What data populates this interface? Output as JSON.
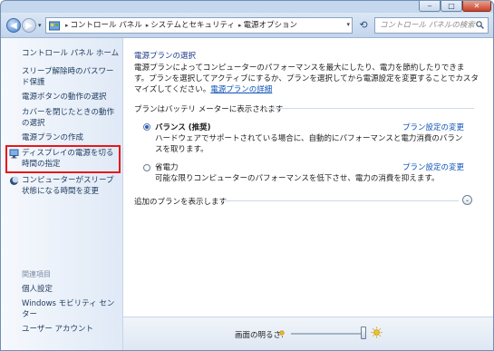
{
  "window": {
    "min": "‒",
    "max": "□",
    "close": "✕"
  },
  "nav": {
    "back": "◀",
    "forward": "▶",
    "dropdown": "▾",
    "breadcrumbs": [
      "コントロール パネル",
      "システムとセキュリティ",
      "電源オプション"
    ],
    "breadcrumb_separator": "▸",
    "address_dropdown": "▾",
    "refresh": "⟲",
    "search_placeholder": "コントロール パネルの検索"
  },
  "help": "?",
  "sidebar": {
    "title": "コントロール パネル ホーム",
    "links": [
      "スリープ解除時のパスワード保護",
      "電源ボタンの動作の選択",
      "カバーを閉じたときの動作の選択",
      "電源プランの作成",
      "ディスプレイの電源を切る時間の指定",
      "コンピューターがスリープ状態になる時間を変更"
    ],
    "related_heading": "関連項目",
    "related_links": [
      "個人設定",
      "Windows モビリティ センター",
      "ユーザー アカウント"
    ]
  },
  "main": {
    "title": "電源プランの選択",
    "description": "電源プランによってコンピューターのパフォーマンスを最大にしたり、電力を節約したりできます。プランを選択してアクティブにするか、プランを選択してから電源設定を変更することでカスタマイズしてください。",
    "description_link": "電源プランの詳細",
    "group_title": "プランはバッテリ メーターに表示されます",
    "plans": [
      {
        "name": "バランス (推奨)",
        "desc": "ハードウェアでサポートされている場合に、自動的にパフォーマンスと電力消費のバランスを取ります。",
        "link": "プラン設定の変更",
        "selected": true
      },
      {
        "name": "省電力",
        "desc": "可能な限りコンピューターのパフォーマンスを低下させ、電力の消費を抑えます。",
        "link": "プラン設定の変更",
        "selected": false
      }
    ],
    "additional": "追加のプランを表示します",
    "expand_icon": "⌄"
  },
  "bottom": {
    "brightness_label": "画面の明るさ:",
    "brightness_level": 1.0
  }
}
